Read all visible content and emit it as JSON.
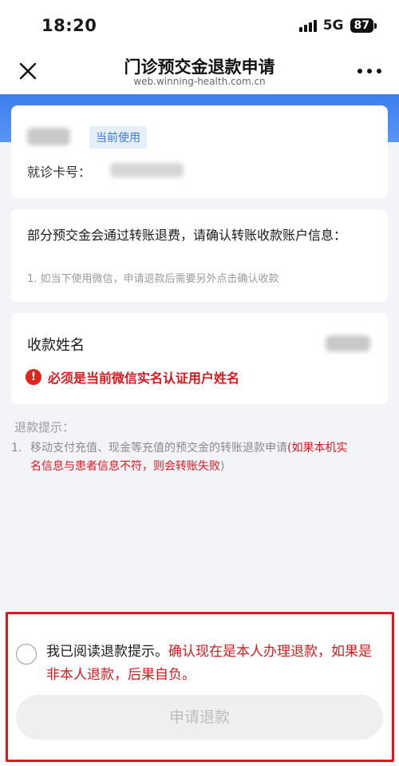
{
  "status": {
    "time": "18:20",
    "network": "5G",
    "battery": "87"
  },
  "nav": {
    "title": "门诊预交金退款申请",
    "subtitle": "web.winning-health.com.cn",
    "close_icon": "close-icon",
    "more_icon": "more-icon"
  },
  "patient": {
    "badge": "当前使用",
    "card_no_label": "就诊卡号："
  },
  "notice": {
    "text": "部分预交金会通过转账退费，请确认转账收款账户信息：",
    "item": "1.  如当下使用微信，申请退款后需要另外点击确认收款"
  },
  "payee": {
    "label": "收款姓名",
    "warning": "必须是当前微信实名认证用户姓名",
    "warning_icon": "exclamation-icon"
  },
  "tips": {
    "title": "退款提示：",
    "num": "1.",
    "line1_normal": "移动支付充值、现金等充值的预交金的转账退款申请",
    "line1_red": "(如果本机实",
    "line2_red": "名信息与患者信息不符，则会转账失败",
    "line2_normal": ")"
  },
  "agree": {
    "normal": "我已阅读退款提示。",
    "red": "确认现在是本人办理退款，如果是非本人退款，后果自负。"
  },
  "submit": {
    "label": "申请退款"
  },
  "colors": {
    "accent": "#3d7ff0",
    "warning": "#d7191f",
    "highlight": "#e3141c"
  }
}
